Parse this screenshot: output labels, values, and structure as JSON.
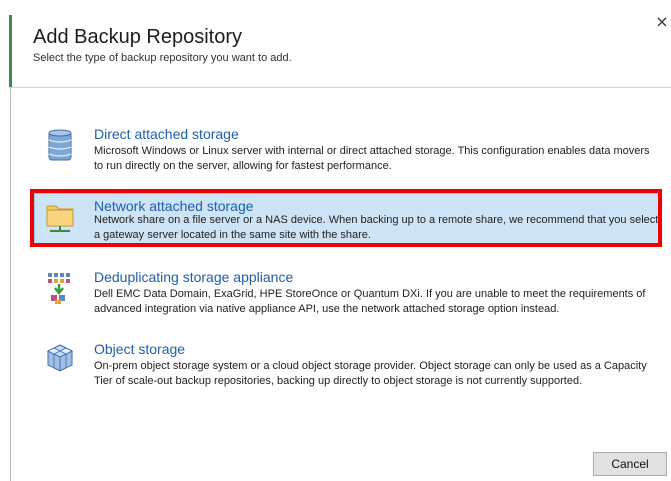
{
  "dialog": {
    "title": "Add Backup Repository",
    "subtitle": "Select the type of backup repository you want to add.",
    "close_glyph": "×"
  },
  "options": [
    {
      "title": "Direct attached storage",
      "description": "Microsoft Windows or Linux server with internal or direct attached storage. This configuration enables data movers to run directly on the server, allowing for fastest performance.",
      "icon": "database-icon",
      "selected": false
    },
    {
      "title": "Network attached storage",
      "description": "Network share on a file server or a NAS device. When backing up to a remote share, we recommend that you select a gateway server located in the same site with the share.",
      "icon": "network-folder-icon",
      "selected": true
    },
    {
      "title": "Deduplicating storage appliance",
      "description": "Dell EMC Data Domain, ExaGrid, HPE StoreOnce or Quantum DXi. If you are unable to meet the requirements of advanced integration via native appliance API, use the network attached storage option instead.",
      "icon": "dedup-appliance-icon",
      "selected": false
    },
    {
      "title": "Object storage",
      "description": "On-prem object storage system or a cloud object storage provider. Object storage can only be used as a Capacity Tier of scale-out backup repositories, backing up directly to object storage is not currently supported.",
      "icon": "object-storage-icon",
      "selected": false
    }
  ],
  "buttons": {
    "cancel": "Cancel"
  },
  "colors": {
    "accent_green": "#3d8b4e",
    "link_blue": "#1f5fa8",
    "selection_bg": "#cde4f7",
    "highlight_red": "#ee0000"
  }
}
